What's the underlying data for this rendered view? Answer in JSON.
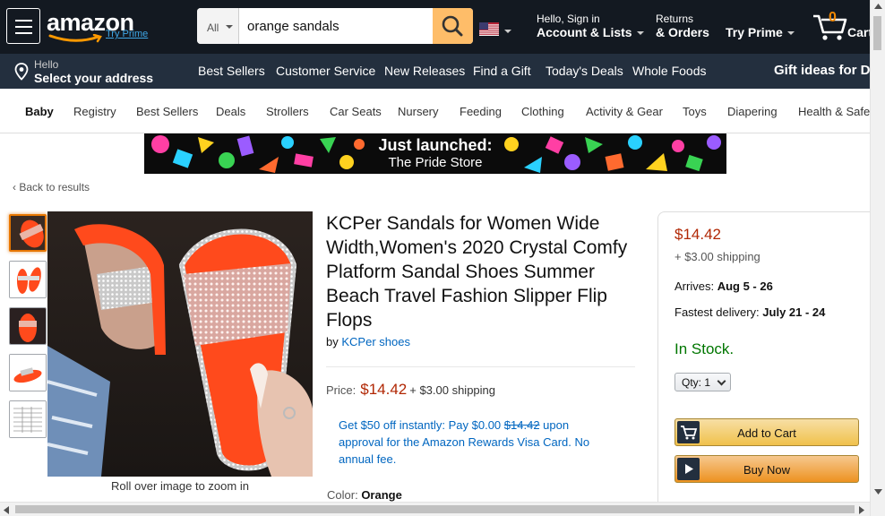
{
  "header": {
    "logo_text": "amazon",
    "logo_prime": "Try Prime",
    "search_category": "All",
    "search_value": "orange sandals",
    "account_line1": "Hello, Sign in",
    "account_line2": "Account & Lists",
    "returns_line1": "Returns",
    "returns_line2": "& Orders",
    "prime_label": "Try Prime",
    "cart_count": "0",
    "cart_label": "Cart"
  },
  "subnav": {
    "location_hello": "Hello",
    "location_select": "Select your address",
    "links": [
      "Best Sellers",
      "Customer Service",
      "New Releases",
      "Find a Gift",
      "Today's Deals",
      "Whole Foods"
    ],
    "gift_ideas": "Gift ideas for Dad"
  },
  "category_bar": {
    "items": [
      "Baby",
      "Registry",
      "Best Sellers",
      "Deals",
      "Strollers",
      "Car Seats",
      "Nursery",
      "Feeding",
      "Clothing",
      "Activity & Gear",
      "Toys",
      "Diapering",
      "Health & Safety"
    ]
  },
  "banner": {
    "title": "Just launched:",
    "subtitle": "The Pride Store"
  },
  "back_link": "Back to results",
  "gallery": {
    "zoom_hint": "Roll over image to zoom in",
    "thumbnail_count": 5
  },
  "product": {
    "title": "KCPer Sandals for Women Wide Width,Women's 2020 Crystal Comfy Platform Sandal Shoes Summer Beach Travel Fashion Slipper Flip Flops",
    "by_prefix": "by",
    "brand": "KCPer shoes",
    "price_label": "Price:",
    "price": "$14.42",
    "shipping": "+ $3.00 shipping",
    "promo_text_1": "Get $50 off instantly: Pay $0.00",
    "promo_strike": "$14.42",
    "promo_text_2": "upon approval for the Amazon Rewards Visa Card. No annual fee.",
    "color_label": "Color:",
    "color_value": "Orange"
  },
  "buybox": {
    "price": "$14.42",
    "shipping": "+ $3.00 shipping",
    "arrives_label": "Arrives:",
    "arrives_value": "Aug 5 - 26",
    "fastest_label": "Fastest delivery:",
    "fastest_value": "July 21 - 24",
    "stock": "In Stock.",
    "qty_label": "Qty:",
    "qty_value": "1",
    "add_to_cart": "Add to Cart",
    "buy_now": "Buy Now"
  },
  "colors": {
    "nav_dark": "#131921",
    "nav_sub": "#232f3e",
    "search_button": "#febd69",
    "price_red": "#b12704",
    "link_blue": "#0066c0",
    "stock_green": "#007600",
    "sandal_orange": "#ff4a1c"
  }
}
